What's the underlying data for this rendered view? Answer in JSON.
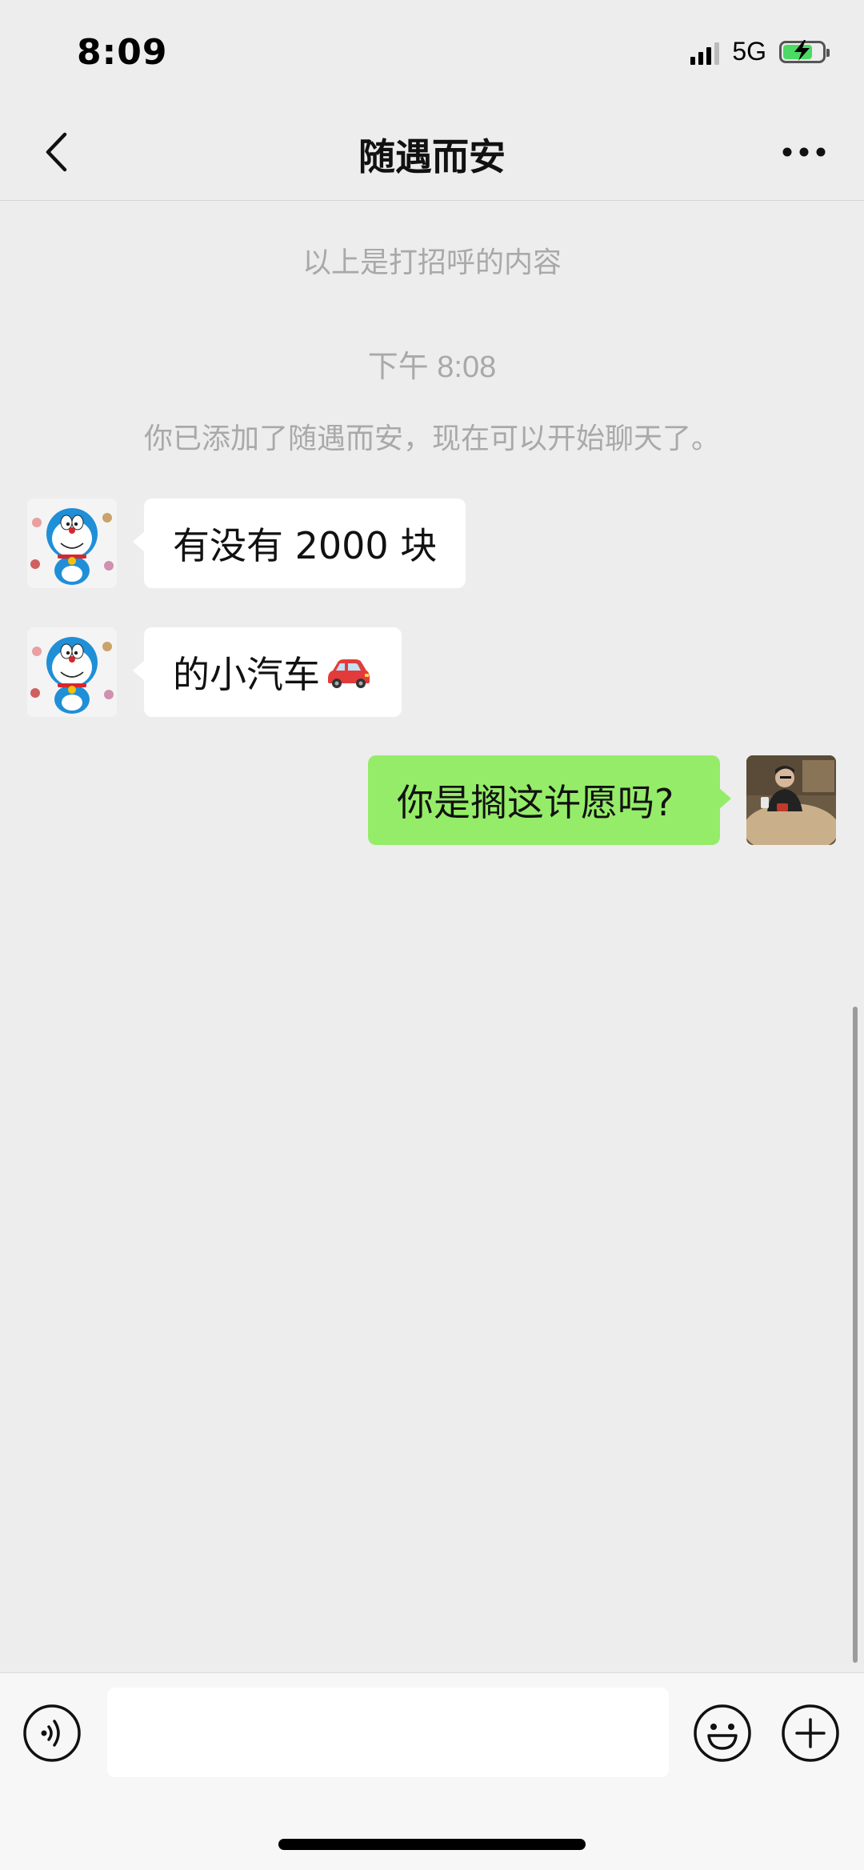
{
  "status_bar": {
    "time": "8:09",
    "network": "5G",
    "battery_level": 0.75
  },
  "nav": {
    "title": "随遇而安",
    "icons": [
      "chevron-left-icon",
      "more-dots-icon"
    ]
  },
  "chat": {
    "system_greeting": "以上是打招呼的内容",
    "timestamp": "下午 8:08",
    "system_added": "你已添加了随遇而安，现在可以开始聊天了。",
    "messages": [
      {
        "direction": "incoming",
        "text": "有没有 2000 块"
      },
      {
        "direction": "incoming",
        "text": "的小汽车",
        "emoji": "car-emoji"
      },
      {
        "direction": "outgoing",
        "text": "你是搁这许愿吗?"
      }
    ]
  },
  "input_bar": {
    "value": "",
    "icons": [
      "voice-icon",
      "emoji-face-icon",
      "plus-icon"
    ]
  },
  "colors": {
    "background": "#ededed",
    "outgoing_bubble": "#95ec69",
    "incoming_bubble": "#ffffff",
    "system_text": "#a9a9a9",
    "battery_fill": "#4cd964"
  }
}
